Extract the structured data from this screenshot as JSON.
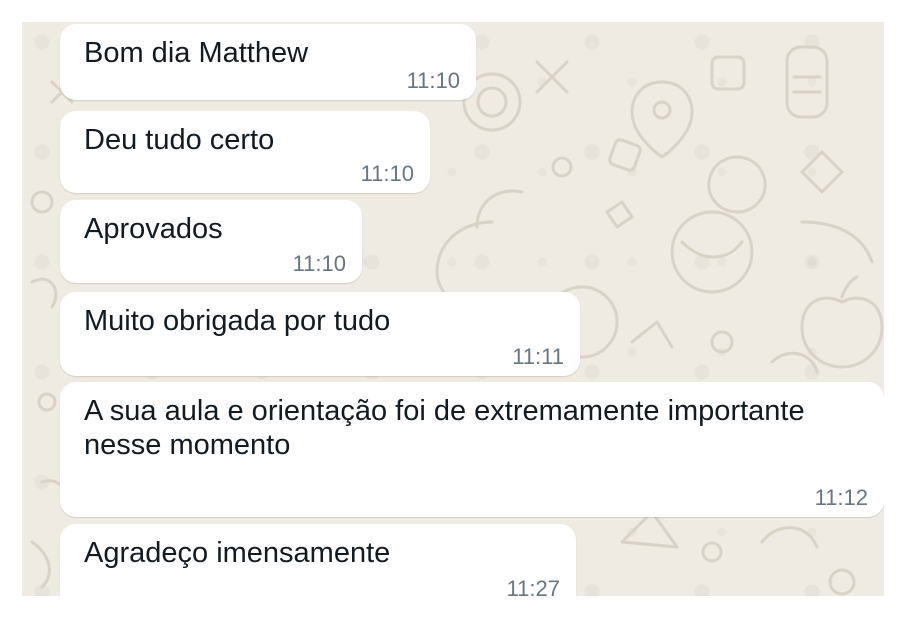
{
  "messages": [
    {
      "text": "Bom dia Matthew",
      "time": "11:10"
    },
    {
      "text": "Deu tudo certo",
      "time": "11:10"
    },
    {
      "text": "Aprovados",
      "time": "11:10"
    },
    {
      "text": "Muito obrigada por tudo",
      "time": "11:11"
    },
    {
      "text": "A sua aula e orientação foi de extremamente importante nesse momento",
      "time": "11:12"
    },
    {
      "text": "Agradeço imensamente",
      "time": "11:27"
    }
  ]
}
